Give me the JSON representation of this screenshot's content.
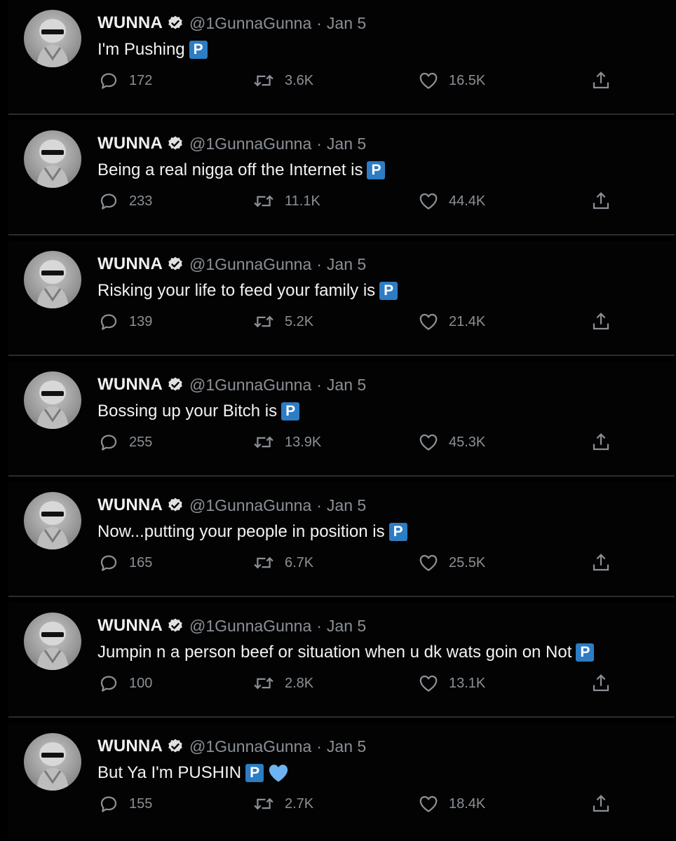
{
  "colors": {
    "background": "#000000",
    "text": "#e7e9ea",
    "muted": "#8b9096",
    "verified_badge": "#e0e0e0",
    "p_emoji": "#2d7cc4",
    "heart_emoji": "#6fb2f2"
  },
  "icons": {
    "verified": "verified-badge-icon",
    "reply": "reply-icon",
    "retweet": "retweet-icon",
    "like": "heart-icon",
    "share": "share-icon",
    "p_emoji": "p-button-emoji",
    "heart_emoji": "blue-heart-emoji"
  },
  "tweets": [
    {
      "name": "WUNNA",
      "handle": "@1GunnaGunna",
      "separator": "·",
      "date": "Jan 5",
      "text": "I'm Pushing",
      "emoji_p": "P",
      "replies": "172",
      "retweets": "3.6K",
      "likes": "16.5K"
    },
    {
      "name": "WUNNA",
      "handle": "@1GunnaGunna",
      "separator": "·",
      "date": "Jan 5",
      "text": "Being a real nigga off the Internet is",
      "emoji_p": "P",
      "replies": "233",
      "retweets": "11.1K",
      "likes": "44.4K"
    },
    {
      "name": "WUNNA",
      "handle": "@1GunnaGunna",
      "separator": "·",
      "date": "Jan 5",
      "text": "Risking your life to feed your family is",
      "emoji_p": "P",
      "replies": "139",
      "retweets": "5.2K",
      "likes": "21.4K"
    },
    {
      "name": "WUNNA",
      "handle": "@1GunnaGunna",
      "separator": "·",
      "date": "Jan 5",
      "text": "Bossing up your Bitch is",
      "emoji_p": "P",
      "replies": "255",
      "retweets": "13.9K",
      "likes": "45.3K"
    },
    {
      "name": "WUNNA",
      "handle": "@1GunnaGunna",
      "separator": "·",
      "date": "Jan 5",
      "text": "Now...putting your people in position is",
      "emoji_p": "P",
      "replies": "165",
      "retweets": "6.7K",
      "likes": "25.5K"
    },
    {
      "name": "WUNNA",
      "handle": "@1GunnaGunna",
      "separator": "·",
      "date": "Jan 5",
      "text": "Jumpin n a person beef or situation when u dk wats goin on Not",
      "emoji_p": "P",
      "replies": "100",
      "retweets": "2.8K",
      "likes": "13.1K"
    },
    {
      "name": "WUNNA",
      "handle": "@1GunnaGunna",
      "separator": "·",
      "date": "Jan 5",
      "text": "But Ya I'm PUSHIN",
      "emoji_p": "P",
      "emoji_heart": "blue-heart-emoji",
      "replies": "155",
      "retweets": "2.7K",
      "likes": "18.4K"
    }
  ]
}
